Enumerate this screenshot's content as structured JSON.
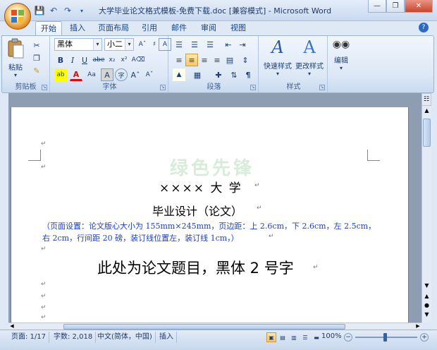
{
  "window": {
    "title": "大学毕业论文格式模板-免费下载.doc [兼容模式] - Microsoft Word"
  },
  "ribbon_tabs": [
    "开始",
    "插入",
    "页面布局",
    "引用",
    "邮件",
    "审阅",
    "视图"
  ],
  "ribbon": {
    "clipboard": {
      "paste_label": "粘贴",
      "group_label": "剪贴板"
    },
    "font": {
      "font_name": "黑体",
      "font_size": "小二",
      "group_label": "字体"
    },
    "paragraph": {
      "group_label": "段落"
    },
    "styles": {
      "quick_styles_label": "快速样式",
      "change_styles_label": "更改样式",
      "group_label": "样式"
    },
    "editing": {
      "label": "编辑"
    }
  },
  "document": {
    "university": "×××× 大 学",
    "subtitle": "毕业设计（论文）",
    "note_line1": "（页面设置：论文版心大小为 155mm×245mm，页边距：上 2.6cm，下 2.6cm，左 2.5cm，",
    "note_line2": "右 2cm，行间距 20 磅，装订线位置左，装订线 1cm，）",
    "thesis_title": "此处为论文题目，黑体 2 号字",
    "watermark": "绿色先锋"
  },
  "status": {
    "page": "页面: 1/17",
    "words": "字数: 2,018",
    "language": "中文(简体，中国)",
    "mode": "插入",
    "zoom": "100%"
  },
  "colors": {
    "note_text": "#1d3fbf",
    "accent": "#15428b"
  }
}
